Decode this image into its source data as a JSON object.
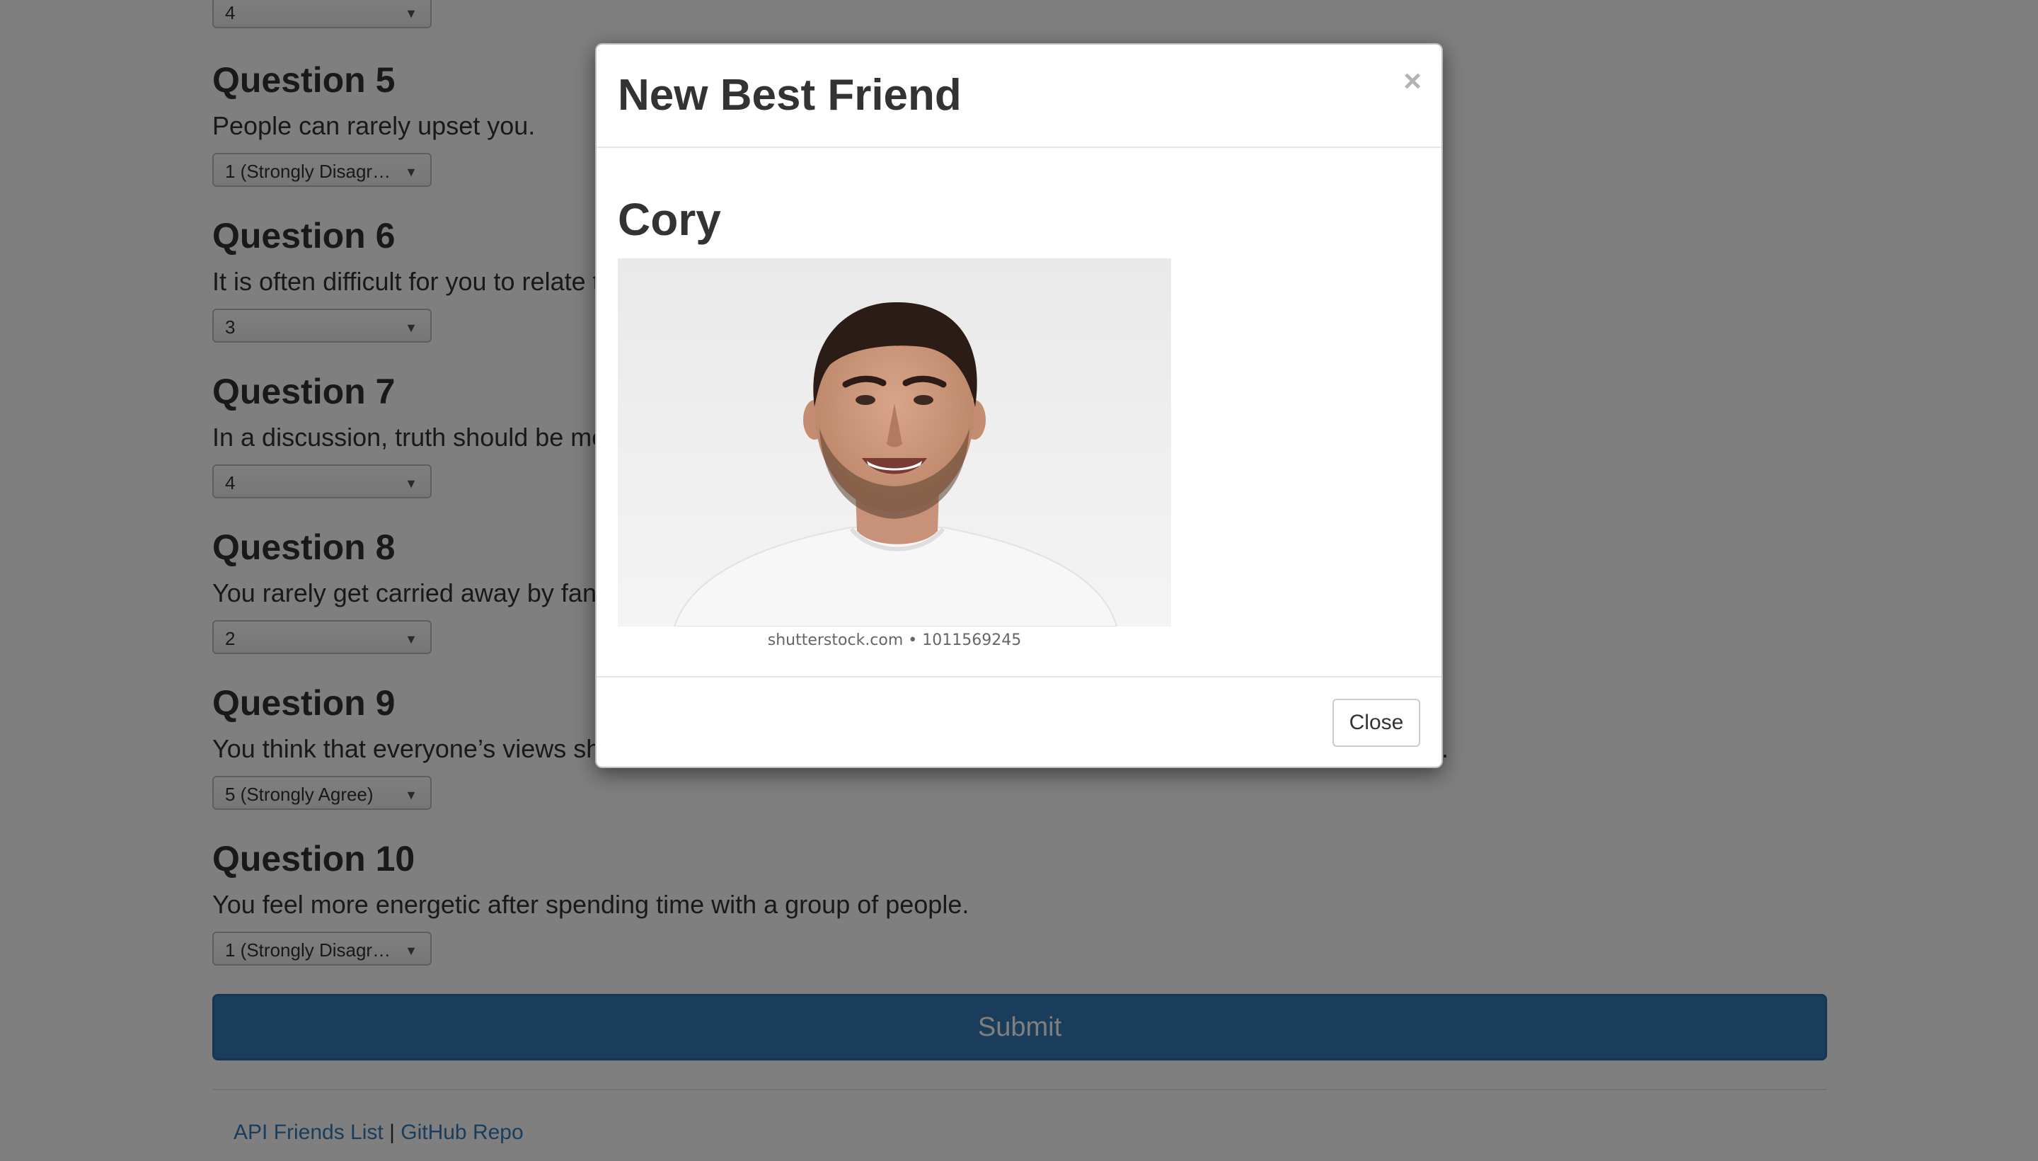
{
  "questions": [
    {
      "title": "",
      "text": "",
      "value": "4"
    },
    {
      "title": "Question 5",
      "text": "People can rarely upset you.",
      "value": "1 (Strongly Disagree)"
    },
    {
      "title": "Question 6",
      "text": "It is often difficult for you to relate to other people’s feelings.",
      "value": "3"
    },
    {
      "title": "Question 7",
      "text": "In a discussion, truth should be more important than people’s sensitivities.",
      "value": "4"
    },
    {
      "title": "Question 8",
      "text": "You rarely get carried away by fantasies and ideas.",
      "value": "2"
    },
    {
      "title": "Question 9",
      "text": "You think that everyone’s views should be respected regardless of whether they are supported by facts or not.",
      "value": "5 (Strongly Agree)"
    },
    {
      "title": "Question 10",
      "text": "You feel more energetic after spending time with a group of people.",
      "value": "1 (Strongly Disagree)"
    }
  ],
  "select_arrow": "▼",
  "submit_label": "Submit",
  "footer": {
    "link1": "API Friends List",
    "separator": "|",
    "link2": "GitHub Repo"
  },
  "modal": {
    "title": "New Best Friend",
    "close_symbol": "×",
    "friend_name": "Cory",
    "photo_watermark": "shutterstock.com • 1011569245",
    "close_label": "Close"
  },
  "colors": {
    "primary": "#337ab7",
    "link": "#337ab7",
    "overlay": "rgba(0,0,0,0.5)"
  }
}
